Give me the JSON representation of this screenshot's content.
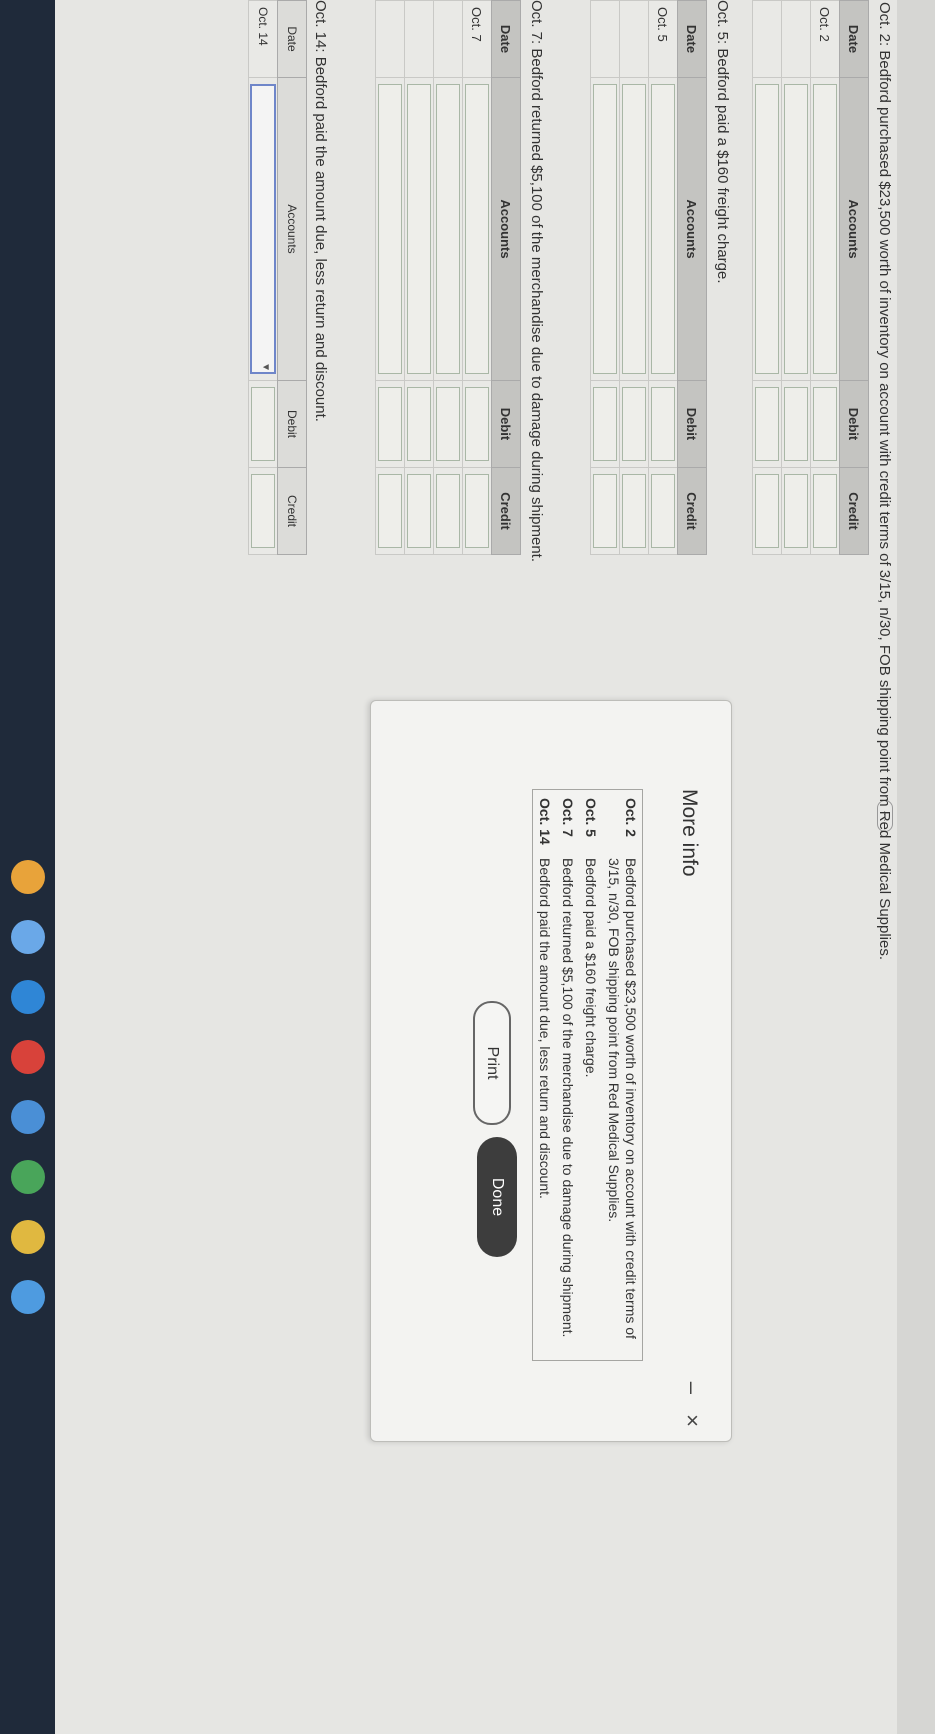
{
  "question": {
    "oct2_title": "Oct. 2: Bedford purchased $23,500 worth of inventory on account with credit terms of 3/15, n/30, FOB shipping point from Red Medical Supplies.",
    "oct5_title": "Oct. 5: Bedford paid a $160 freight charge.",
    "oct7_title": "Oct. 7: Bedford returned $5,100 of the merchandise due to damage during shipment.",
    "oct14_title": "Oct. 14: Bedford paid the amount due, less return and discount."
  },
  "table_headers": {
    "date": "Date",
    "accounts": "Accounts",
    "debit": "Debit",
    "credit": "Credit"
  },
  "journal": {
    "oct2": {
      "date": "Oct. 2"
    },
    "oct5": {
      "date": "Oct. 5"
    },
    "oct7": {
      "date": "Oct. 7"
    },
    "oct14": {
      "date": "Oct. 14"
    }
  },
  "modal": {
    "title": "More info",
    "minimize": "–",
    "close": "×",
    "items": [
      {
        "date": "Oct. 2",
        "text": "Bedford purchased $23,500 worth of inventory on account with credit terms of 3/15, n/30, FOB shipping point from Red Medical Supplies."
      },
      {
        "date": "Oct. 5",
        "text": "Bedford paid a $160 freight charge."
      },
      {
        "date": "Oct. 7",
        "text": "Bedford returned $5,100 of the merchandise due to damage during shipment."
      },
      {
        "date": "Oct. 14",
        "text": "Bedford paid the amount due, less return and discount."
      }
    ],
    "print_label": "Print",
    "done_label": "Done"
  },
  "ellipsis": "....",
  "colors": {
    "accent": "#6f86c9",
    "done_button": "#3d3d3d",
    "taskbar": "#1f2a3a"
  }
}
